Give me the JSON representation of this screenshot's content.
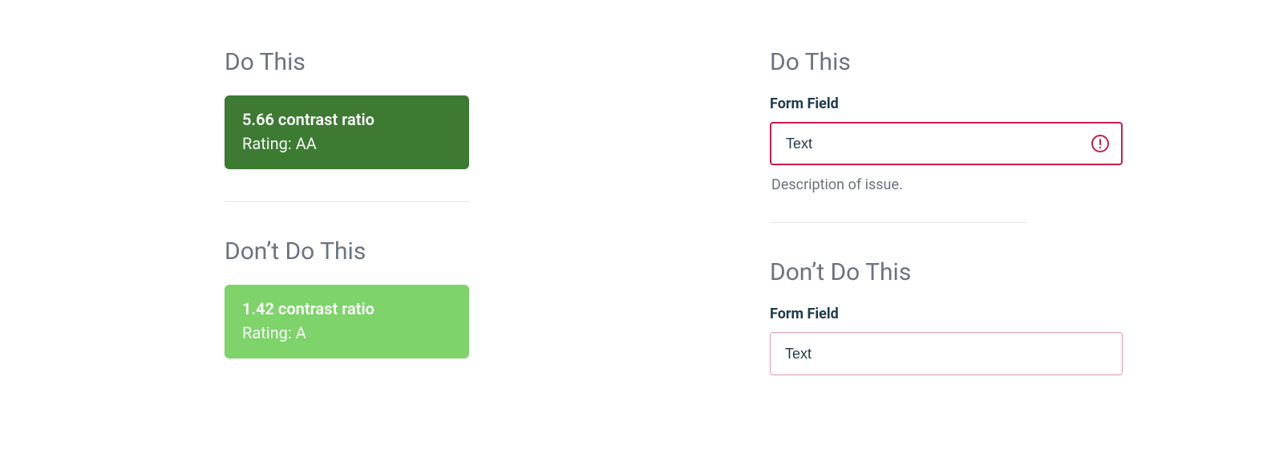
{
  "left": {
    "do": {
      "heading": "Do This",
      "ratio": "5.66 contrast ratio",
      "rating": "Rating: AA",
      "bg_color": "#3d7a32"
    },
    "dont": {
      "heading": "Don’t Do This",
      "ratio": "1.42 contrast ratio",
      "rating": "Rating: A",
      "bg_color": "#7ed36b"
    }
  },
  "right": {
    "do": {
      "heading": "Do This",
      "label": "Form Field",
      "value": "Text",
      "help": "Description of issue.",
      "border_color": "#c81e4a",
      "icon": "alert-circle-icon"
    },
    "dont": {
      "heading": "Don’t Do This",
      "label": "Form Field",
      "value": "Text",
      "border_color": "#e89aad"
    }
  }
}
